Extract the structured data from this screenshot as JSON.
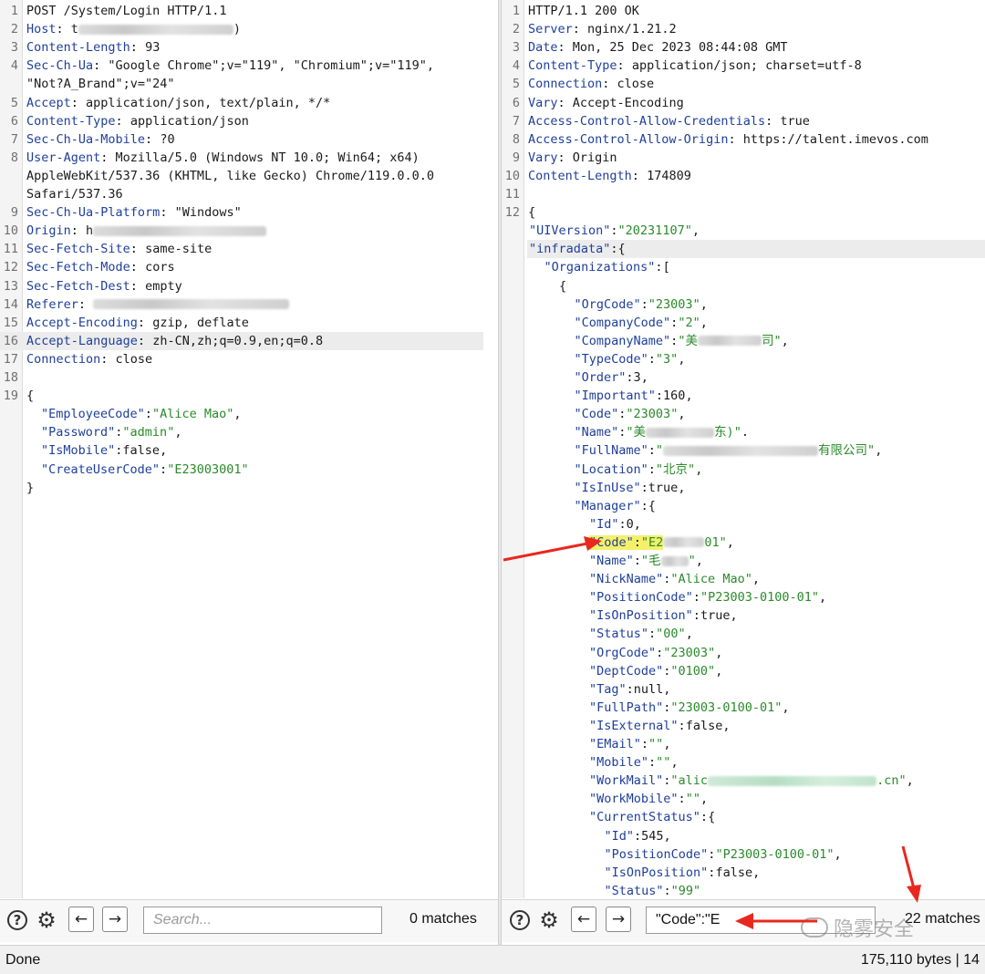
{
  "request": {
    "lines": [
      {
        "ln": "1",
        "key": "POST /System/Login HTTP/1.1",
        "sep": "",
        "val": "",
        "blur": 0,
        "trail": ""
      },
      {
        "ln": "2",
        "key": "Host",
        "sep": ": ",
        "val": "t",
        "blur": 170,
        "trail": ")"
      },
      {
        "ln": "3",
        "key": "Content-Length",
        "sep": ": ",
        "val": "93",
        "blur": 0,
        "trail": ""
      },
      {
        "ln": "4",
        "key": "Sec-Ch-Ua",
        "sep": ": ",
        "val": "\"Google Chrome\";v=\"119\", \"Chromium\";v=\"119\",",
        "blur": 0,
        "trail": ""
      },
      {
        "ln": "",
        "key": "",
        "sep": "",
        "val": "\"Not?A_Brand\";v=\"24\"",
        "blur": 0,
        "trail": ""
      },
      {
        "ln": "5",
        "key": "Accept",
        "sep": ": ",
        "val": "application/json, text/plain, */*",
        "blur": 0,
        "trail": ""
      },
      {
        "ln": "6",
        "key": "Content-Type",
        "sep": ": ",
        "val": "application/json",
        "blur": 0,
        "trail": ""
      },
      {
        "ln": "7",
        "key": "Sec-Ch-Ua-Mobile",
        "sep": ": ",
        "val": "?0",
        "blur": 0,
        "trail": ""
      },
      {
        "ln": "8",
        "key": "User-Agent",
        "sep": ": ",
        "val": "Mozilla/5.0 (Windows NT 10.0; Win64; x64)",
        "blur": 0,
        "trail": ""
      },
      {
        "ln": "",
        "key": "",
        "sep": "",
        "val": "AppleWebKit/537.36 (KHTML, like Gecko) Chrome/119.0.0.0",
        "blur": 0,
        "trail": ""
      },
      {
        "ln": "",
        "key": "",
        "sep": "",
        "val": "Safari/537.36",
        "blur": 0,
        "trail": ""
      },
      {
        "ln": "9",
        "key": "Sec-Ch-Ua-Platform",
        "sep": ": ",
        "val": "\"Windows\"",
        "blur": 0,
        "trail": ""
      },
      {
        "ln": "10",
        "key": "Origin",
        "sep": ": ",
        "val": "h",
        "blur": 190,
        "trail": ""
      },
      {
        "ln": "11",
        "key": "Sec-Fetch-Site",
        "sep": ": ",
        "val": "same-site",
        "blur": 0,
        "trail": ""
      },
      {
        "ln": "12",
        "key": "Sec-Fetch-Mode",
        "sep": ": ",
        "val": "cors",
        "blur": 0,
        "trail": ""
      },
      {
        "ln": "13",
        "key": "Sec-Fetch-Dest",
        "sep": ": ",
        "val": "empty",
        "blur": 0,
        "trail": ""
      },
      {
        "ln": "14",
        "key": "Referer",
        "sep": ": ",
        "val": "",
        "blur": 215,
        "trail": ""
      },
      {
        "ln": "15",
        "key": "Accept-Encoding",
        "sep": ": ",
        "val": "gzip, deflate",
        "blur": 0,
        "trail": ""
      },
      {
        "ln": "16",
        "key": "Accept-Language",
        "sep": ": ",
        "val": "zh-CN,zh;q=0.9,en;q=0.8",
        "blur": 0,
        "trail": "",
        "hl": true
      },
      {
        "ln": "17",
        "key": "Connection",
        "sep": ": ",
        "val": "close",
        "blur": 0,
        "trail": ""
      },
      {
        "ln": "18",
        "key": "",
        "sep": "",
        "val": "",
        "blur": 0,
        "trail": ""
      },
      {
        "ln": "19",
        "key": "",
        "sep": "",
        "val": "{",
        "blur": 0,
        "trail": ""
      }
    ],
    "body": [
      {
        "key": "\"EmployeeCode\"",
        "val": "\"Alice Mao\"",
        "comma": ","
      },
      {
        "key": "\"Password\"",
        "val": "\"admin\"",
        "comma": ","
      },
      {
        "key": "\"IsMobile\"",
        "val": "false",
        "comma": ",",
        "plain": true
      },
      {
        "key": "\"CreateUserCode\"",
        "val": "\"E23003001\"",
        "comma": ""
      }
    ],
    "close": "}"
  },
  "response": {
    "headers": [
      {
        "ln": "1",
        "key": "HTTP/1.1 200 OK",
        "sep": "",
        "val": ""
      },
      {
        "ln": "2",
        "key": "Server",
        "sep": ": ",
        "val": "nginx/1.21.2"
      },
      {
        "ln": "3",
        "key": "Date",
        "sep": ": ",
        "val": "Mon, 25 Dec 2023 08:44:08 GMT"
      },
      {
        "ln": "4",
        "key": "Content-Type",
        "sep": ": ",
        "val": "application/json; charset=utf-8"
      },
      {
        "ln": "5",
        "key": "Connection",
        "sep": ": ",
        "val": "close"
      },
      {
        "ln": "6",
        "key": "Vary",
        "sep": ": ",
        "val": "Accept-Encoding"
      },
      {
        "ln": "7",
        "key": "Access-Control-Allow-Credentials",
        "sep": ": ",
        "val": "true"
      },
      {
        "ln": "8",
        "key": "Access-Control-Allow-Origin",
        "sep": ": ",
        "val": "https://talent.imevos.com"
      },
      {
        "ln": "9",
        "key": "Vary",
        "sep": ": ",
        "val": "Origin"
      },
      {
        "ln": "10",
        "key": "Content-Length",
        "sep": ": ",
        "val": "174809"
      },
      {
        "ln": "11",
        "key": "",
        "sep": "",
        "val": ""
      },
      {
        "ln": "12",
        "key": "",
        "sep": "",
        "val": "{"
      }
    ],
    "json": [
      {
        "ind": 1,
        "key": "\"UIVersion\"",
        "val": "\"20231107\"",
        "comma": ","
      },
      {
        "ind": 1,
        "key": "\"infradata\"",
        "val": "{",
        "comma": "",
        "plain": true,
        "hl": true
      },
      {
        "ind": 2,
        "key": "\"Organizations\"",
        "val": "[",
        "comma": "",
        "plain": true
      },
      {
        "ind": 3,
        "key": "",
        "val": "{",
        "comma": "",
        "plain": true
      },
      {
        "ind": 4,
        "key": "\"OrgCode\"",
        "val": "\"23003\"",
        "comma": ","
      },
      {
        "ind": 4,
        "key": "\"CompanyCode\"",
        "val": "\"2\"",
        "comma": ","
      },
      {
        "ind": 4,
        "key": "\"CompanyName\"",
        "val": "\"美",
        "comma": ",",
        "blur": 70,
        "trail": "司\""
      },
      {
        "ind": 4,
        "key": "\"TypeCode\"",
        "val": "\"3\"",
        "comma": ","
      },
      {
        "ind": 4,
        "key": "\"Order\"",
        "val": "3",
        "comma": ",",
        "plain": true
      },
      {
        "ind": 4,
        "key": "\"Important\"",
        "val": "160",
        "comma": ",",
        "plain": true
      },
      {
        "ind": 4,
        "key": "\"Code\"",
        "val": "\"23003\"",
        "comma": ","
      },
      {
        "ind": 4,
        "key": "\"Name\"",
        "val": "\"美",
        "comma": ".",
        "blur": 75,
        "trail": "东)\""
      },
      {
        "ind": 4,
        "key": "\"FullName\"",
        "val": "\"",
        "comma": ",",
        "blur": 170,
        "trail": "有限公司\""
      },
      {
        "ind": 4,
        "key": "\"Location\"",
        "val": "\"北京\"",
        "comma": ","
      },
      {
        "ind": 4,
        "key": "\"IsInUse\"",
        "val": "true",
        "comma": ",",
        "plain": true
      },
      {
        "ind": 4,
        "key": "\"Manager\"",
        "val": "{",
        "comma": "",
        "plain": true
      },
      {
        "ind": 5,
        "key": "\"Id\"",
        "val": "0",
        "comma": ",",
        "plain": true
      },
      {
        "ind": 5,
        "key": "\"Code\"",
        "val": "\"E2",
        "comma": ",",
        "blur": 45,
        "trail": "01\"",
        "mark": true
      },
      {
        "ind": 5,
        "key": "\"Name\"",
        "val": "\"毛",
        "comma": ",",
        "blur": 30,
        "trail": "\""
      },
      {
        "ind": 5,
        "key": "\"NickName\"",
        "val": "\"Alice Mao\"",
        "comma": ","
      },
      {
        "ind": 5,
        "key": "\"PositionCode\"",
        "val": "\"P23003-0100-01\"",
        "comma": ","
      },
      {
        "ind": 5,
        "key": "\"IsOnPosition\"",
        "val": "true",
        "comma": ",",
        "plain": true
      },
      {
        "ind": 5,
        "key": "\"Status\"",
        "val": "\"00\"",
        "comma": ","
      },
      {
        "ind": 5,
        "key": "\"OrgCode\"",
        "val": "\"23003\"",
        "comma": ","
      },
      {
        "ind": 5,
        "key": "\"DeptCode\"",
        "val": "\"0100\"",
        "comma": ","
      },
      {
        "ind": 5,
        "key": "\"Tag\"",
        "val": "null",
        "comma": ",",
        "plain": true
      },
      {
        "ind": 5,
        "key": "\"FullPath\"",
        "val": "\"23003-0100-01\"",
        "comma": ","
      },
      {
        "ind": 5,
        "key": "\"IsExternal\"",
        "val": "false",
        "comma": ",",
        "plain": true
      },
      {
        "ind": 5,
        "key": "\"EMail\"",
        "val": "\"\"",
        "comma": ","
      },
      {
        "ind": 5,
        "key": "\"Mobile\"",
        "val": "\"\"",
        "comma": ","
      },
      {
        "ind": 5,
        "key": "\"WorkMail\"",
        "val": "\"alic",
        "comma": ",",
        "blur": 185,
        "trail": ".cn\"",
        "green": true
      },
      {
        "ind": 5,
        "key": "\"WorkMobile\"",
        "val": "\"\"",
        "comma": ","
      },
      {
        "ind": 5,
        "key": "\"CurrentStatus\"",
        "val": "{",
        "comma": "",
        "plain": true
      },
      {
        "ind": 6,
        "key": "\"Id\"",
        "val": "545",
        "comma": ",",
        "plain": true
      },
      {
        "ind": 6,
        "key": "\"PositionCode\"",
        "val": "\"P23003-0100-01\"",
        "comma": ","
      },
      {
        "ind": 6,
        "key": "\"IsOnPosition\"",
        "val": "false",
        "comma": ",",
        "plain": true
      },
      {
        "ind": 6,
        "key": "\"Status\"",
        "val": "\"99\"",
        "comma": ""
      }
    ]
  },
  "toolbar_left": {
    "search_placeholder": "Search...",
    "matches": "0 matches"
  },
  "toolbar_right": {
    "search_value": "\"Code\":\"E",
    "matches": "22 matches"
  },
  "status": {
    "left": "Done",
    "right": "175,110 bytes | 14"
  },
  "watermark": "隐雾安全",
  "icons": {
    "help": "help-icon",
    "settings": "gear-icon",
    "back": "arrow-left-icon",
    "forward": "arrow-right-icon"
  },
  "colors": {
    "key": "#1f3f9a",
    "string": "#2a8a2a",
    "highlight": "#f4f06a",
    "annotation": "#e8281e"
  }
}
